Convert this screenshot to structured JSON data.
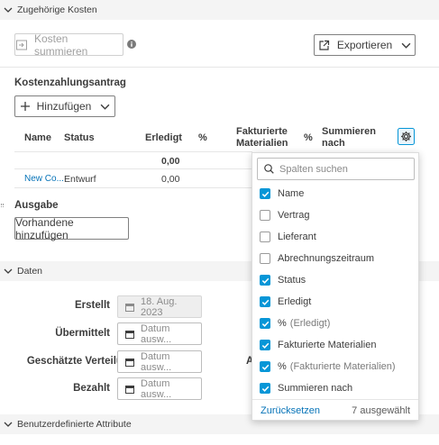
{
  "sections": {
    "costs_title": "Zugehörige Kosten",
    "data_title": "Daten",
    "custom_title": "Benutzerdefinierte Attribute"
  },
  "toolbar": {
    "sum_costs_label": "Kosten summieren",
    "export_label": "Exportieren"
  },
  "payment_request": {
    "title": "Kostenzahlungsantrag",
    "add_label": "Hinzufügen",
    "columns": {
      "name": "Name",
      "status": "Status",
      "done": "Erledigt",
      "percent1": "%",
      "invoiced_line1": "Fakturierte",
      "invoiced_line2": "Materialien",
      "percent2": "%",
      "sum_line1": "Summieren",
      "sum_line2": "nach"
    },
    "total_done": "0,00",
    "row": {
      "name": "New Co...",
      "status": "Entwurf",
      "done": "0,00"
    }
  },
  "expense": {
    "title": "Ausgabe",
    "add_existing_label": "Vorhandene hinzufügen"
  },
  "data_fields": {
    "created_label": "Erstellt",
    "created_value": "18. Aug. 2023",
    "submitted_label": "Übermittelt",
    "estimated_label": "Geschätzte Verteilung",
    "paid_label": "Bezahlt",
    "date_placeholder": "Datum ausw...",
    "partial_label": "A"
  },
  "column_picker": {
    "search_placeholder": "Spalten suchen",
    "options": [
      {
        "label": "Name",
        "checked": true
      },
      {
        "label": "Vertrag",
        "checked": false
      },
      {
        "label": "Lieferant",
        "checked": false
      },
      {
        "label": "Abrechnungszeitraum",
        "checked": false
      },
      {
        "label": "Status",
        "checked": true
      },
      {
        "label": "Erledigt",
        "checked": true
      },
      {
        "label": "%",
        "sub": "(Erledigt)",
        "checked": true
      },
      {
        "label": "Fakturierte Materialien",
        "checked": true
      },
      {
        "label": "%",
        "sub": "(Fakturierte Materialien)",
        "checked": true
      },
      {
        "label": "Summieren nach",
        "checked": true
      }
    ],
    "reset_label": "Zurücksetzen",
    "selected_count": "7 ausgewählt"
  },
  "colors": {
    "accent": "#0696d7",
    "link": "#0673b8",
    "section_bg": "#f4f4f4"
  },
  "icons": [
    "chevron-down-icon",
    "sum-icon",
    "info-icon",
    "export-icon",
    "plus-icon",
    "gear-icon",
    "search-icon",
    "calendar-icon",
    "check-icon"
  ]
}
